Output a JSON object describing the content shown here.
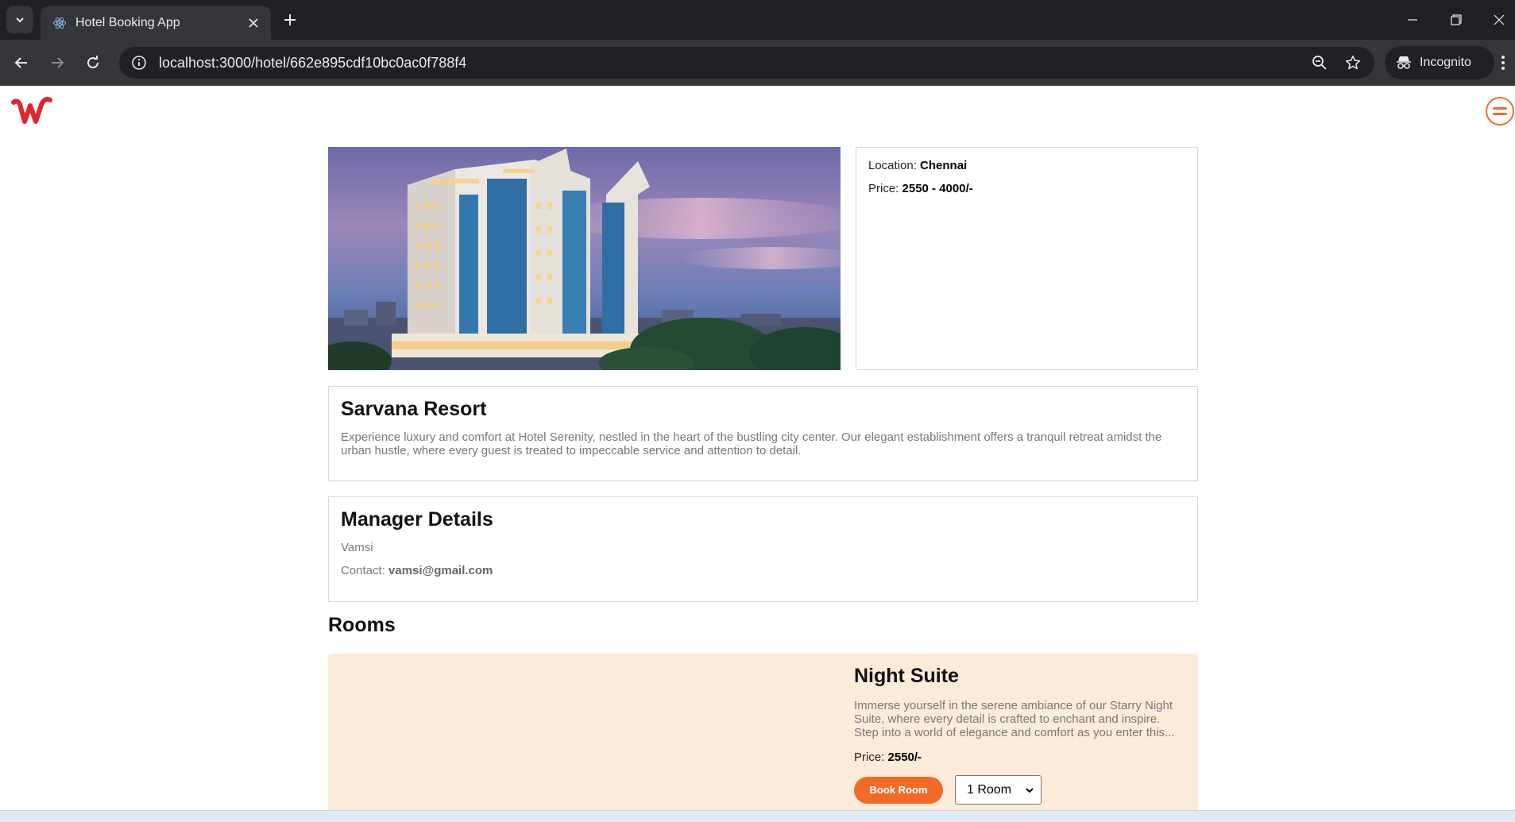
{
  "browser": {
    "tab_title": "Hotel Booking App",
    "url": "localhost:3000/hotel/662e895cdf10bc0ac0f788f4",
    "incognito_label": "Incognito"
  },
  "hotel": {
    "location_label": "Location: ",
    "location": "Chennai",
    "price_label": "Price: ",
    "price": "2550 - 4000/-",
    "name": "Sarvana Resort",
    "description": "Experience luxury and comfort at Hotel Serenity, nestled in the heart of the bustling city center. Our elegant establishment offers a tranquil retreat amidst the urban hustle, where every guest is treated to impeccable service and attention to detail."
  },
  "manager": {
    "heading": "Manager Details",
    "name": "Vamsi",
    "contact_label": "Contact: ",
    "email": "vamsi@gmail.com"
  },
  "rooms": {
    "heading": "Rooms",
    "items": [
      {
        "name": "Night Suite",
        "description": "Immerse yourself in the serene ambiance of our Starry Night Suite, where every detail is crafted to enchant and inspire. Step into a world of elegance and comfort as you enter this...",
        "price_label": "Price: ",
        "price": "2550/-",
        "book_label": "Book Room",
        "room_count": "1 Room"
      }
    ]
  },
  "colors": {
    "accent": "#f26a2a",
    "logo_red": "#e0252f",
    "room_card_bg": "#fdebd9"
  }
}
